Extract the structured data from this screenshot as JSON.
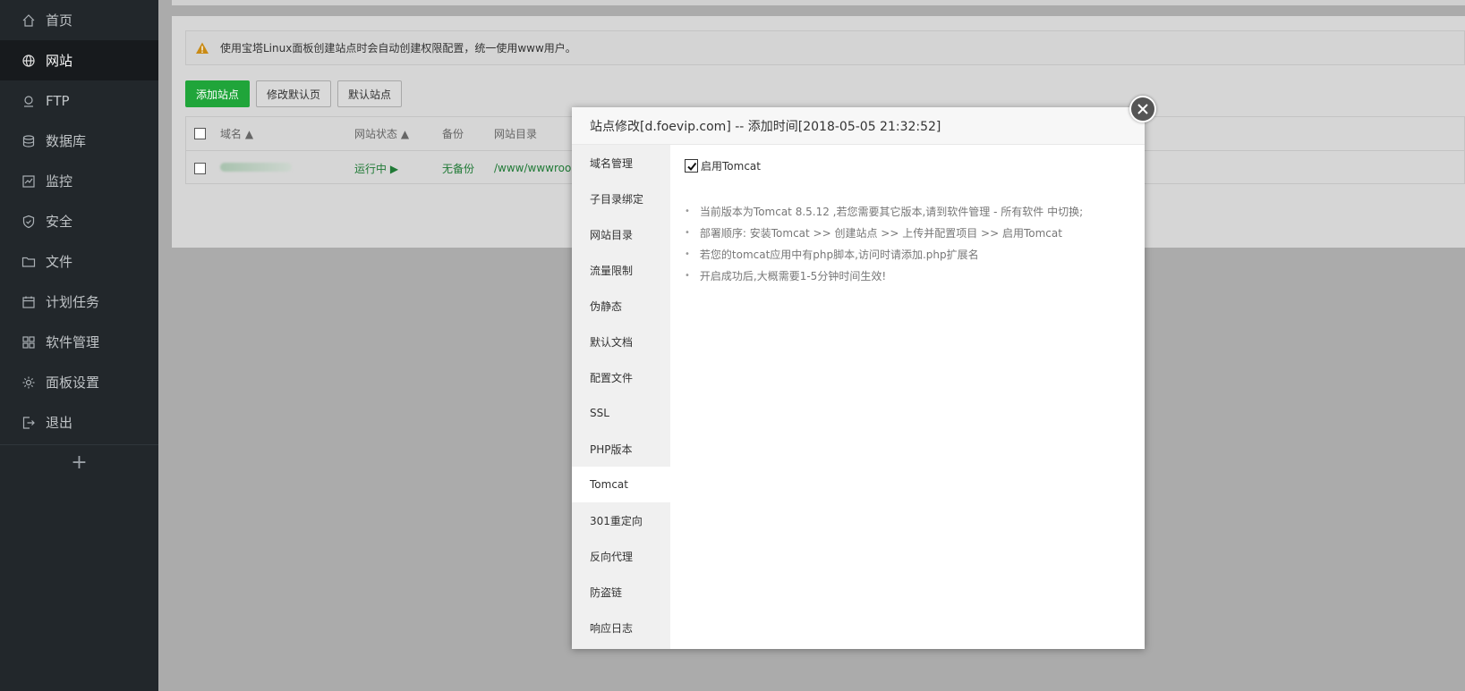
{
  "sidebar": {
    "items": [
      {
        "label": "首页",
        "icon": "home-icon",
        "active": false
      },
      {
        "label": "网站",
        "icon": "globe-icon",
        "active": true
      },
      {
        "label": "FTP",
        "icon": "ftp-icon",
        "active": false
      },
      {
        "label": "数据库",
        "icon": "database-icon",
        "active": false
      },
      {
        "label": "监控",
        "icon": "monitor-icon",
        "active": false
      },
      {
        "label": "安全",
        "icon": "shield-icon",
        "active": false
      },
      {
        "label": "文件",
        "icon": "folder-icon",
        "active": false
      },
      {
        "label": "计划任务",
        "icon": "calendar-icon",
        "active": false
      },
      {
        "label": "软件管理",
        "icon": "grid-icon",
        "active": false
      },
      {
        "label": "面板设置",
        "icon": "gear-icon",
        "active": false
      },
      {
        "label": "退出",
        "icon": "logout-icon",
        "active": false
      }
    ],
    "add_label": "+"
  },
  "main": {
    "alert_text": "使用宝塔Linux面板创建站点时会自动创建权限配置，统一使用www用户。",
    "buttons": {
      "add_site": "添加站点",
      "edit_default_page": "修改默认页",
      "default_site": "默认站点"
    },
    "table": {
      "headers": {
        "domain": "域名 ▲",
        "status": "网站状态 ▲",
        "backup": "备份",
        "dir": "网站目录"
      },
      "row": {
        "status": "运行中 ▶",
        "backup": "无备份",
        "dir": "/www/wwwroo"
      }
    }
  },
  "modal": {
    "title": "站点修改[d.foevip.com] -- 添加时间[2018-05-05 21:32:52]",
    "tabs": [
      {
        "label": "域名管理",
        "active": false
      },
      {
        "label": "子目录绑定",
        "active": false
      },
      {
        "label": "网站目录",
        "active": false
      },
      {
        "label": "流量限制",
        "active": false
      },
      {
        "label": "伪静态",
        "active": false
      },
      {
        "label": "默认文档",
        "active": false
      },
      {
        "label": "配置文件",
        "active": false
      },
      {
        "label": "SSL",
        "active": false
      },
      {
        "label": "PHP版本",
        "active": false
      },
      {
        "label": "Tomcat",
        "active": true
      },
      {
        "label": "301重定向",
        "active": false
      },
      {
        "label": "反向代理",
        "active": false
      },
      {
        "label": "防盗链",
        "active": false
      },
      {
        "label": "响应日志",
        "active": false
      }
    ],
    "enable_tomcat": {
      "label": "启用Tomcat",
      "checked": true
    },
    "tips": [
      "当前版本为Tomcat 8.5.12 ,若您需要其它版本,请到软件管理 - 所有软件 中切换;",
      "部署顺序: 安装Tomcat >> 创建站点 >> 上传并配置项目 >> 启用Tomcat",
      "若您的tomcat应用中有php脚本,访问时请添加.php扩展名",
      "开启成功后,大概需要1-5分钟时间生效!"
    ]
  },
  "colors": {
    "sidebar_bg": "#22272b",
    "sidebar_active_bg": "#171a1d",
    "accent_green": "#20a53a",
    "overlay": "#ababab"
  }
}
